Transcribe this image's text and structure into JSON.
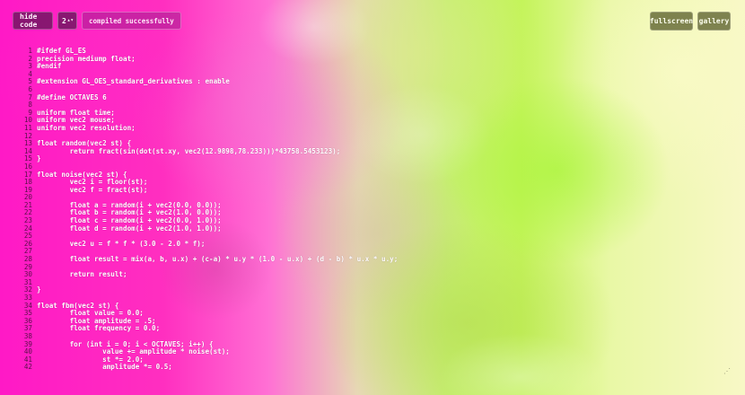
{
  "toolbar": {
    "hide_code_label": "hide code",
    "version_value": "2",
    "status_text": "compiled successfully",
    "fullscreen_label": "fullscreen",
    "gallery_label": "gallery"
  },
  "editor": {
    "lines": [
      {
        "n": "1",
        "text": "#ifdef GL_ES"
      },
      {
        "n": "2",
        "text": "precision mediump float;"
      },
      {
        "n": "3",
        "text": "#endif"
      },
      {
        "n": "4",
        "text": ""
      },
      {
        "n": "5",
        "text": "#extension GL_OES_standard_derivatives : enable"
      },
      {
        "n": "6",
        "text": ""
      },
      {
        "n": "7",
        "text": "#define OCTAVES 6"
      },
      {
        "n": "8",
        "text": ""
      },
      {
        "n": "9",
        "text": "uniform float time;"
      },
      {
        "n": "10",
        "text": "uniform vec2 mouse;"
      },
      {
        "n": "11",
        "text": "uniform vec2 resolution;"
      },
      {
        "n": "12",
        "text": ""
      },
      {
        "n": "13",
        "text": "float random(vec2 st) {"
      },
      {
        "n": "14",
        "text": "        return fract(sin(dot(st.xy, vec2(12.9898,78.233)))*43758.5453123);"
      },
      {
        "n": "15",
        "text": "}"
      },
      {
        "n": "16",
        "text": ""
      },
      {
        "n": "17",
        "text": "float noise(vec2 st) {"
      },
      {
        "n": "18",
        "text": "        vec2 i = floor(st);"
      },
      {
        "n": "19",
        "text": "        vec2 f = fract(st);"
      },
      {
        "n": "20",
        "text": ""
      },
      {
        "n": "21",
        "text": "        float a = random(i + vec2(0.0, 0.0));"
      },
      {
        "n": "22",
        "text": "        float b = random(i + vec2(1.0, 0.0));"
      },
      {
        "n": "23",
        "text": "        float c = random(i + vec2(0.0, 1.0));"
      },
      {
        "n": "24",
        "text": "        float d = random(i + vec2(1.0, 1.0));"
      },
      {
        "n": "25",
        "text": ""
      },
      {
        "n": "26",
        "text": "        vec2 u = f * f * (3.0 - 2.0 * f);"
      },
      {
        "n": "27",
        "text": ""
      },
      {
        "n": "28",
        "text": "        float result = mix(a, b, u.x) + (c-a) * u.y * (1.0 - u.x) + (d - b) * u.x * u.y;"
      },
      {
        "n": "29",
        "text": ""
      },
      {
        "n": "30",
        "text": "        return result;"
      },
      {
        "n": "31",
        "text": ""
      },
      {
        "n": "32",
        "text": "}"
      },
      {
        "n": "33",
        "text": ""
      },
      {
        "n": "34",
        "text": "float fbm(vec2 st) {"
      },
      {
        "n": "35",
        "text": "        float value = 0.0;"
      },
      {
        "n": "36",
        "text": "        float amplitude = .5;"
      },
      {
        "n": "37",
        "text": "        float frequency = 0.0;"
      },
      {
        "n": "38",
        "text": ""
      },
      {
        "n": "39",
        "text": "        for (int i = 0; i < OCTAVES; i++) {"
      },
      {
        "n": "40",
        "text": "                value += amplitude * noise(st);"
      },
      {
        "n": "41",
        "text": "                st *= 2.0;"
      },
      {
        "n": "42",
        "text": "                amplitude *= 0.5;"
      }
    ]
  }
}
